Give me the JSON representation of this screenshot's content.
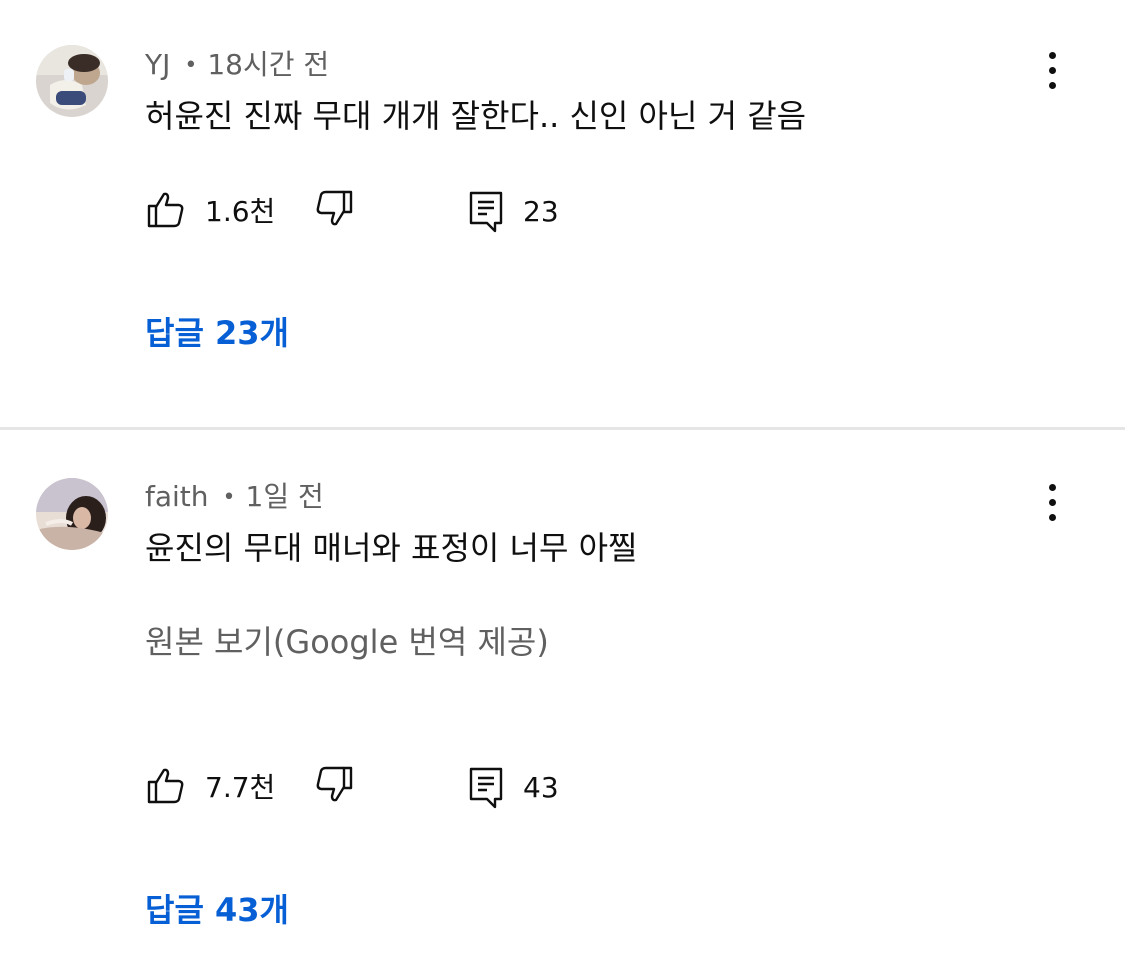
{
  "comments": [
    {
      "author": "YJ",
      "time": "18시간 전",
      "text": "허윤진 진짜 무대 개개 잘한다.. 신인 아닌 거 같음",
      "likes": "1.6천",
      "reply_count": "23",
      "replies_label": "답글 23개",
      "avatar_colors": [
        "#d9d4cf",
        "#3b4b7a",
        "#f3efe9"
      ]
    },
    {
      "author": "faith",
      "time": "1일 전",
      "text": "윤진의 무대 매너와 표정이 너무 아찔",
      "translation_link": "원본 보기(Google 번역 제공)",
      "likes": "7.7천",
      "reply_count": "43",
      "replies_label": "답글 43개",
      "avatar_colors": [
        "#c9b2a6",
        "#2b1f1c",
        "#e8ded6"
      ]
    }
  ],
  "meta_separator": "•",
  "icons": {
    "like": "thumbs-up-icon",
    "dislike": "thumbs-down-icon",
    "reply": "comment-icon",
    "menu": "more-vert-icon"
  },
  "colors": {
    "link": "#065fd4",
    "secondary_text": "#606060",
    "primary_text": "#0f0f0f",
    "divider": "#e5e5e5"
  }
}
